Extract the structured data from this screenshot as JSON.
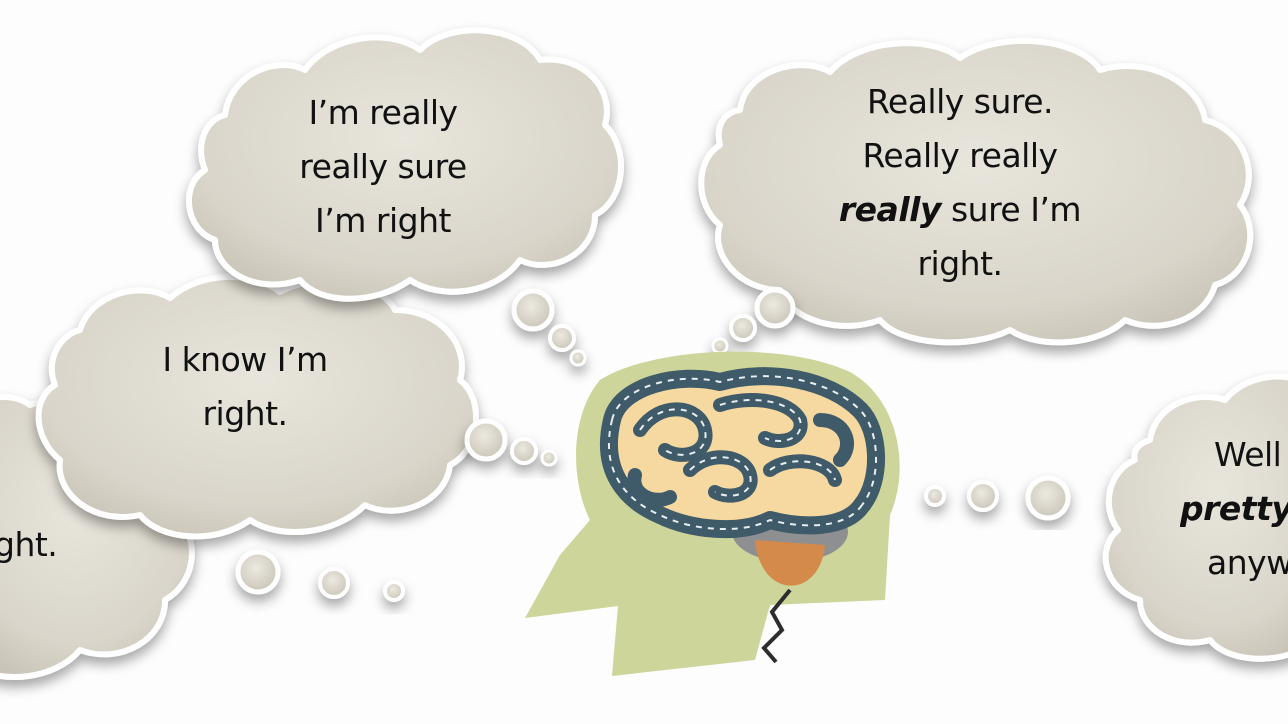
{
  "thoughts": {
    "far_left": {
      "lines": [
        "ght."
      ]
    },
    "left": {
      "lines": [
        "I know I’m",
        "right."
      ]
    },
    "top_left": {
      "lines": [
        "I’m really",
        "really sure",
        "I’m right"
      ]
    },
    "top_right": {
      "line1": "Really sure.",
      "line2": "Really really",
      "line3_emphasis": "really",
      "line3_rest": " sure I’m",
      "line4": "right."
    },
    "right": {
      "line1": "Well",
      "line2_emphasis": "pretty",
      "line3": "anyw"
    }
  },
  "colors": {
    "bubble_fill": "#dcd8ce",
    "bubble_edge": "#ffffff",
    "head": "#cdd59a",
    "brain_fill": "#f6d9a0",
    "brain_road": "#3f5a68",
    "brain_road_edge": "#2e4350",
    "cerebellum": "#8d8f91",
    "brainstem": "#d38a4a"
  }
}
